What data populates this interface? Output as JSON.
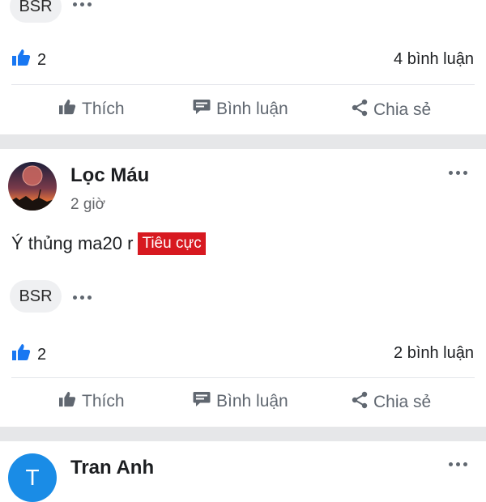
{
  "post_top": {
    "chip_label": "BSR",
    "like_count": "2",
    "comment_count": "4 bình luận"
  },
  "post_1": {
    "author": "Lọc Máu",
    "time": "2 giờ",
    "content": "Ý thủng ma20 r",
    "sentiment_tag": "Tiêu cực",
    "chip_label": "BSR",
    "like_count": "2",
    "comment_count": "2 bình luận"
  },
  "post_2": {
    "avatar_letter": "T",
    "author": "Tran Anh"
  },
  "actions": {
    "like": "Thích",
    "comment": "Bình luận",
    "share": "Chia sẻ"
  },
  "colors": {
    "like_blue": "#1877f2",
    "tag_red": "#d71920",
    "avatar_blue": "#1a8ce6",
    "separator_band": "#e6e7e9"
  },
  "icons": [
    "like-icon",
    "thumbs-up-icon",
    "comment-icon",
    "share-icon",
    "more-options-icon"
  ]
}
